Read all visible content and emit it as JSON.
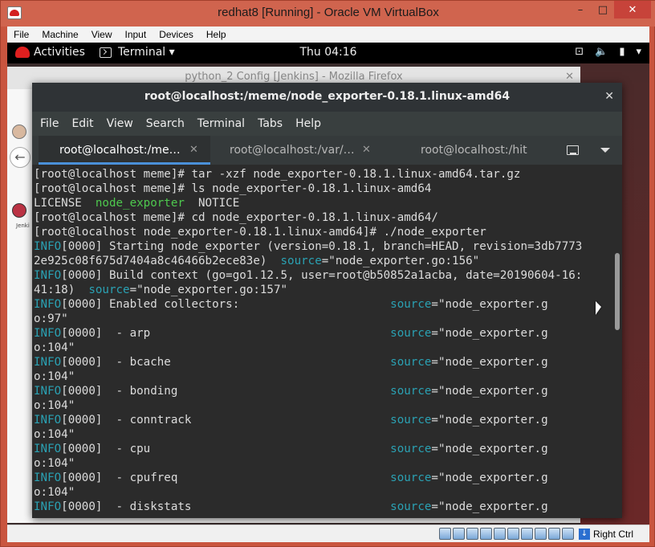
{
  "host_window": {
    "title": "redhat8 [Running] - Oracle VM VirtualBox",
    "minimize": "–",
    "maximize": "□",
    "close": "✕",
    "menu": [
      "File",
      "Machine",
      "View",
      "Input",
      "Devices",
      "Help"
    ],
    "host_key": "Right Ctrl"
  },
  "gnome_bar": {
    "activities": "Activities",
    "app_menu": "Terminal ▾",
    "clock": "Thu 04:16",
    "network_icon": "⊡",
    "volume_icon": "🔈",
    "battery_icon": "▮",
    "menu_icon": "▾"
  },
  "firefox": {
    "title": "python_2 Config [Jenkins] - Mozilla Firefox",
    "close": "✕",
    "back_glyph": "←",
    "jenkins_label": "Jenki"
  },
  "terminal": {
    "title": "root@localhost:/meme/node_exporter-0.18.1.linux-amd64",
    "close": "✕",
    "menu": [
      "File",
      "Edit",
      "View",
      "Search",
      "Terminal",
      "Tabs",
      "Help"
    ],
    "tabs": [
      {
        "label": "root@localhost:/me…",
        "close": "✕",
        "active": true
      },
      {
        "label": "root@localhost:/var/…",
        "close": "✕",
        "active": false
      },
      {
        "label": "root@localhost:/hit",
        "close": "",
        "active": false
      }
    ],
    "lines": [
      [
        {
          "t": "[root@localhost meme]# tar -xzf node_exporter-0.18.1.linux-amd64.tar.gz",
          "c": ""
        }
      ],
      [
        {
          "t": "[root@localhost meme]# ls node_exporter-0.18.1.linux-amd64",
          "c": ""
        }
      ],
      [
        {
          "t": "LICENSE  ",
          "c": ""
        },
        {
          "t": "node_exporter",
          "c": "green"
        },
        {
          "t": "  NOTICE",
          "c": ""
        }
      ],
      [
        {
          "t": "[root@localhost meme]# cd node_exporter-0.18.1.linux-amd64/",
          "c": ""
        }
      ],
      [
        {
          "t": "[root@localhost node_exporter-0.18.1.linux-amd64]# ./node_exporter",
          "c": ""
        }
      ],
      [
        {
          "t": "INFO",
          "c": "cyan"
        },
        {
          "t": "[0000] Starting node_exporter (version=0.18.1, branch=HEAD, revision=3db7773",
          "c": ""
        }
      ],
      [
        {
          "t": "2e925c08f675d7404a8c46466b2ece83e)  ",
          "c": ""
        },
        {
          "t": "source",
          "c": "cyan"
        },
        {
          "t": "=\"node_exporter.go:156\"",
          "c": ""
        }
      ],
      [
        {
          "t": "INFO",
          "c": "cyan"
        },
        {
          "t": "[0000] Build context (go=go1.12.5, user=root@b50852a1acba, date=20190604-16:",
          "c": ""
        }
      ],
      [
        {
          "t": "41:18)  ",
          "c": ""
        },
        {
          "t": "source",
          "c": "cyan"
        },
        {
          "t": "=\"node_exporter.go:157\"",
          "c": ""
        }
      ],
      [
        {
          "t": "INFO",
          "c": "cyan"
        },
        {
          "t": "[0000] Enabled collectors:                      ",
          "c": ""
        },
        {
          "t": "source",
          "c": "cyan"
        },
        {
          "t": "=\"node_exporter.g",
          "c": ""
        }
      ],
      [
        {
          "t": "o:97\"",
          "c": ""
        }
      ],
      [
        {
          "t": "INFO",
          "c": "cyan"
        },
        {
          "t": "[0000]  - arp                                   ",
          "c": ""
        },
        {
          "t": "source",
          "c": "cyan"
        },
        {
          "t": "=\"node_exporter.g",
          "c": ""
        }
      ],
      [
        {
          "t": "o:104\"",
          "c": ""
        }
      ],
      [
        {
          "t": "INFO",
          "c": "cyan"
        },
        {
          "t": "[0000]  - bcache                                ",
          "c": ""
        },
        {
          "t": "source",
          "c": "cyan"
        },
        {
          "t": "=\"node_exporter.g",
          "c": ""
        }
      ],
      [
        {
          "t": "o:104\"",
          "c": ""
        }
      ],
      [
        {
          "t": "INFO",
          "c": "cyan"
        },
        {
          "t": "[0000]  - bonding                               ",
          "c": ""
        },
        {
          "t": "source",
          "c": "cyan"
        },
        {
          "t": "=\"node_exporter.g",
          "c": ""
        }
      ],
      [
        {
          "t": "o:104\"",
          "c": ""
        }
      ],
      [
        {
          "t": "INFO",
          "c": "cyan"
        },
        {
          "t": "[0000]  - conntrack                             ",
          "c": ""
        },
        {
          "t": "source",
          "c": "cyan"
        },
        {
          "t": "=\"node_exporter.g",
          "c": ""
        }
      ],
      [
        {
          "t": "o:104\"",
          "c": ""
        }
      ],
      [
        {
          "t": "INFO",
          "c": "cyan"
        },
        {
          "t": "[0000]  - cpu                                   ",
          "c": ""
        },
        {
          "t": "source",
          "c": "cyan"
        },
        {
          "t": "=\"node_exporter.g",
          "c": ""
        }
      ],
      [
        {
          "t": "o:104\"",
          "c": ""
        }
      ],
      [
        {
          "t": "INFO",
          "c": "cyan"
        },
        {
          "t": "[0000]  - cpufreq                               ",
          "c": ""
        },
        {
          "t": "source",
          "c": "cyan"
        },
        {
          "t": "=\"node_exporter.g",
          "c": ""
        }
      ],
      [
        {
          "t": "o:104\"",
          "c": ""
        }
      ],
      [
        {
          "t": "INFO",
          "c": "cyan"
        },
        {
          "t": "[0000]  - diskstats                             ",
          "c": ""
        },
        {
          "t": "source",
          "c": "cyan"
        },
        {
          "t": "=\"node_exporter.g",
          "c": ""
        }
      ]
    ]
  },
  "colors": {
    "terminal_bg": "#2b2b2b",
    "terminal_fg": "#dcdcdc",
    "ansi_green": "#4ec94e",
    "ansi_cyan": "#2aa1b3",
    "active_tab_accent": "#4a90d9"
  }
}
